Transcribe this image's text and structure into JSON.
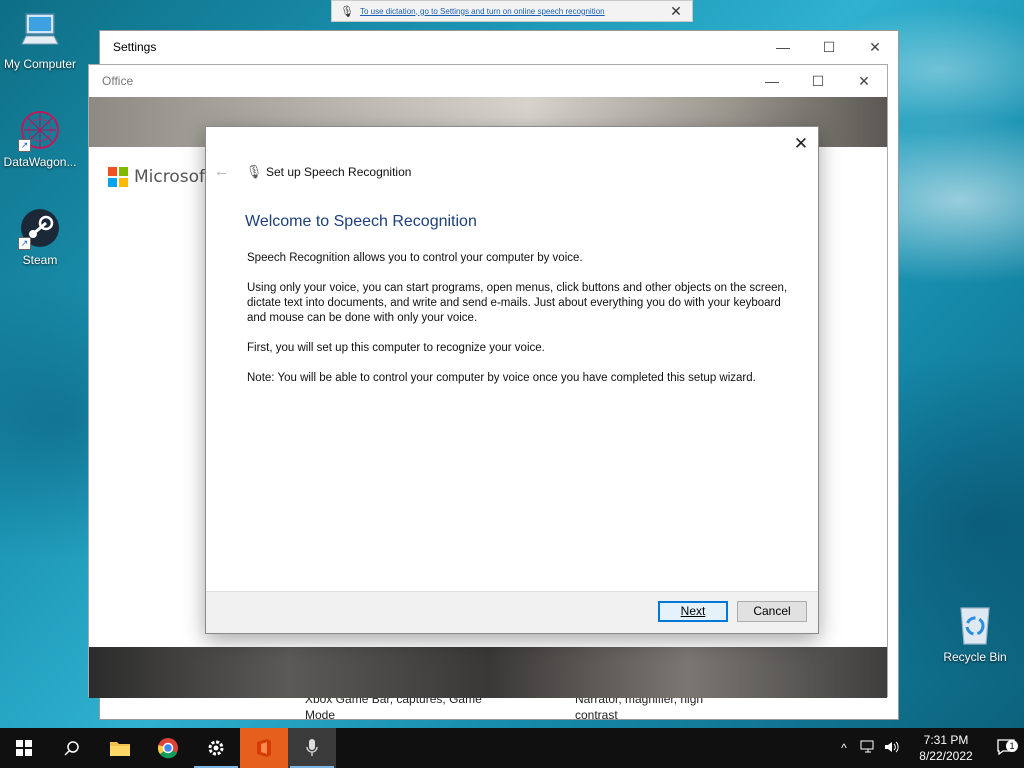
{
  "desktop": {
    "icons": [
      {
        "label": "My Computer",
        "icon": "computer-icon"
      },
      {
        "label": "DataWagon...",
        "icon": "datawagon-icon"
      },
      {
        "label": "Steam",
        "icon": "steam-icon"
      }
    ],
    "recycle_bin": {
      "label": "Recycle Bin",
      "icon": "recycle-bin-icon"
    }
  },
  "dictation_banner": {
    "message": "To use dictation, go to Settings and turn on online speech recognition",
    "icon": "microphone-icon",
    "close_glyph": "✕"
  },
  "settings_window": {
    "title": "Settings",
    "bottom_left": "Xbox Game Bar, captures, Game\nMode",
    "bottom_right": "Narrator, magnifier, high\ncontrast"
  },
  "office_window": {
    "title": "Office",
    "brand": "Microsoft",
    "brand_colors": [
      "#f25022",
      "#7fba00",
      "#00a4ef",
      "#ffb900"
    ]
  },
  "window_controls": {
    "minimize": "—",
    "maximize": "☐",
    "close": "✕"
  },
  "wizard": {
    "header_title": "Set up Speech Recognition",
    "heading": "Welcome to Speech Recognition",
    "paragraphs": [
      "Speech Recognition allows you to control your computer by voice.",
      "Using only your voice, you can start programs, open menus, click buttons and other objects on the screen, dictate text into documents, and write and send e-mails. Just about everything you do with your keyboard and mouse can be done with only your voice.",
      "First, you will set up this computer to recognize your voice.",
      "Note: You will be able to control your computer by voice once you have completed this setup wizard."
    ],
    "next_label": "Next",
    "cancel_label": "Cancel",
    "close_glyph": "✕",
    "back_glyph": "←",
    "accent": "#1e3f7a"
  },
  "taskbar": {
    "items": [
      {
        "name": "start",
        "icon": "windows-start-icon"
      },
      {
        "name": "search",
        "icon": "search-icon"
      },
      {
        "name": "file-explorer",
        "icon": "folder-icon"
      },
      {
        "name": "chrome",
        "icon": "chrome-icon"
      },
      {
        "name": "settings",
        "icon": "gear-icon"
      },
      {
        "name": "office",
        "icon": "office-icon"
      },
      {
        "name": "speech",
        "icon": "microphone-icon"
      }
    ],
    "time": "7:31 PM",
    "date": "8/22/2022",
    "notification_count": "1",
    "tray_chevron": "^"
  }
}
